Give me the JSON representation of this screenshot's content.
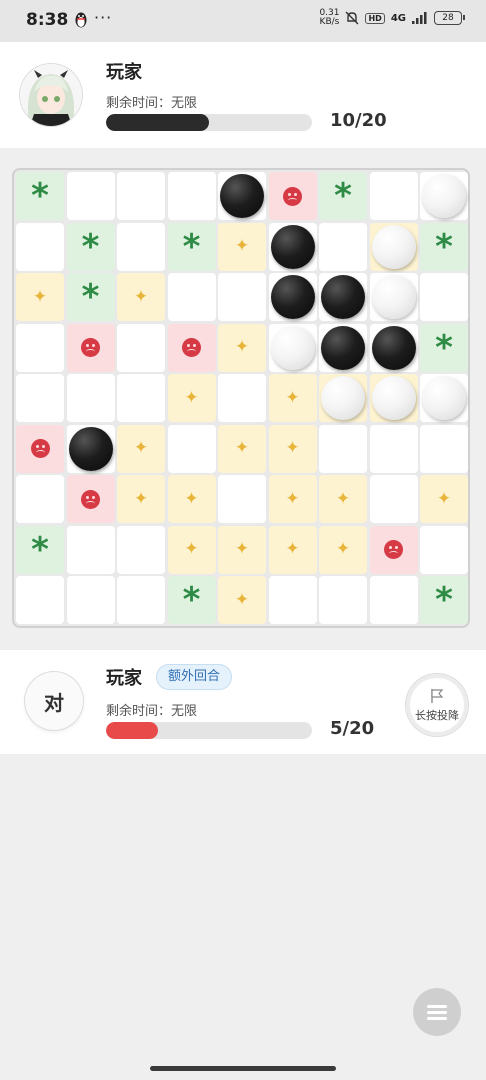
{
  "status_bar": {
    "time": "8:38",
    "dots": "···",
    "speed_value": "0.31",
    "speed_unit": "KB/s",
    "hd": "HD",
    "network": "4G",
    "battery": "28"
  },
  "opponent": {
    "name": "玩家",
    "time_text": "剩余时间：无限",
    "progress_text": "10/20",
    "progress": 0.5,
    "bar_color": "#2b2b2b"
  },
  "player": {
    "name": "玩家",
    "turn_label": "对",
    "badge": "额外回合",
    "time_text": "剩余时间：无限",
    "progress_text": "5/20",
    "progress": 0.25,
    "bar_color": "#e84a4a",
    "surrender_label": "长按投降"
  },
  "board": {
    "size": 9,
    "cells": [
      [
        "G",
        "W",
        "W",
        "W",
        "W",
        "R",
        "G",
        "W",
        "W"
      ],
      [
        "W",
        "G",
        "W",
        "G",
        "Y",
        "W",
        "W",
        "Y",
        "G"
      ],
      [
        "Y",
        "G",
        "Y",
        "W",
        "W",
        "W",
        "W",
        "W",
        "W"
      ],
      [
        "W",
        "R",
        "W",
        "R",
        "Y",
        "W",
        "W",
        "W",
        "G"
      ],
      [
        "W",
        "W",
        "W",
        "Y",
        "W",
        "Y",
        "Y",
        "Y",
        "W"
      ],
      [
        "R",
        "W",
        "Y",
        "W",
        "Y",
        "Y",
        "W",
        "W",
        "W"
      ],
      [
        "W",
        "R",
        "Y",
        "Y",
        "W",
        "Y",
        "Y",
        "W",
        "Y"
      ],
      [
        "G",
        "W",
        "W",
        "Y",
        "Y",
        "Y",
        "Y",
        "R",
        "W"
      ],
      [
        "W",
        "W",
        "W",
        "G",
        "Y",
        "W",
        "W",
        "W",
        "G"
      ]
    ],
    "stones": [
      {
        "row": 0,
        "col": 4,
        "color": "black"
      },
      {
        "row": 0,
        "col": 8,
        "color": "white"
      },
      {
        "row": 1,
        "col": 5,
        "color": "black"
      },
      {
        "row": 1,
        "col": 7,
        "color": "white"
      },
      {
        "row": 2,
        "col": 5,
        "color": "black"
      },
      {
        "row": 2,
        "col": 6,
        "color": "black"
      },
      {
        "row": 2,
        "col": 7,
        "color": "white"
      },
      {
        "row": 3,
        "col": 5,
        "color": "white"
      },
      {
        "row": 3,
        "col": 6,
        "color": "black"
      },
      {
        "row": 3,
        "col": 7,
        "color": "black"
      },
      {
        "row": 4,
        "col": 6,
        "color": "white"
      },
      {
        "row": 4,
        "col": 7,
        "color": "white"
      },
      {
        "row": 4,
        "col": 8,
        "color": "white"
      },
      {
        "row": 5,
        "col": 1,
        "color": "black"
      }
    ]
  }
}
